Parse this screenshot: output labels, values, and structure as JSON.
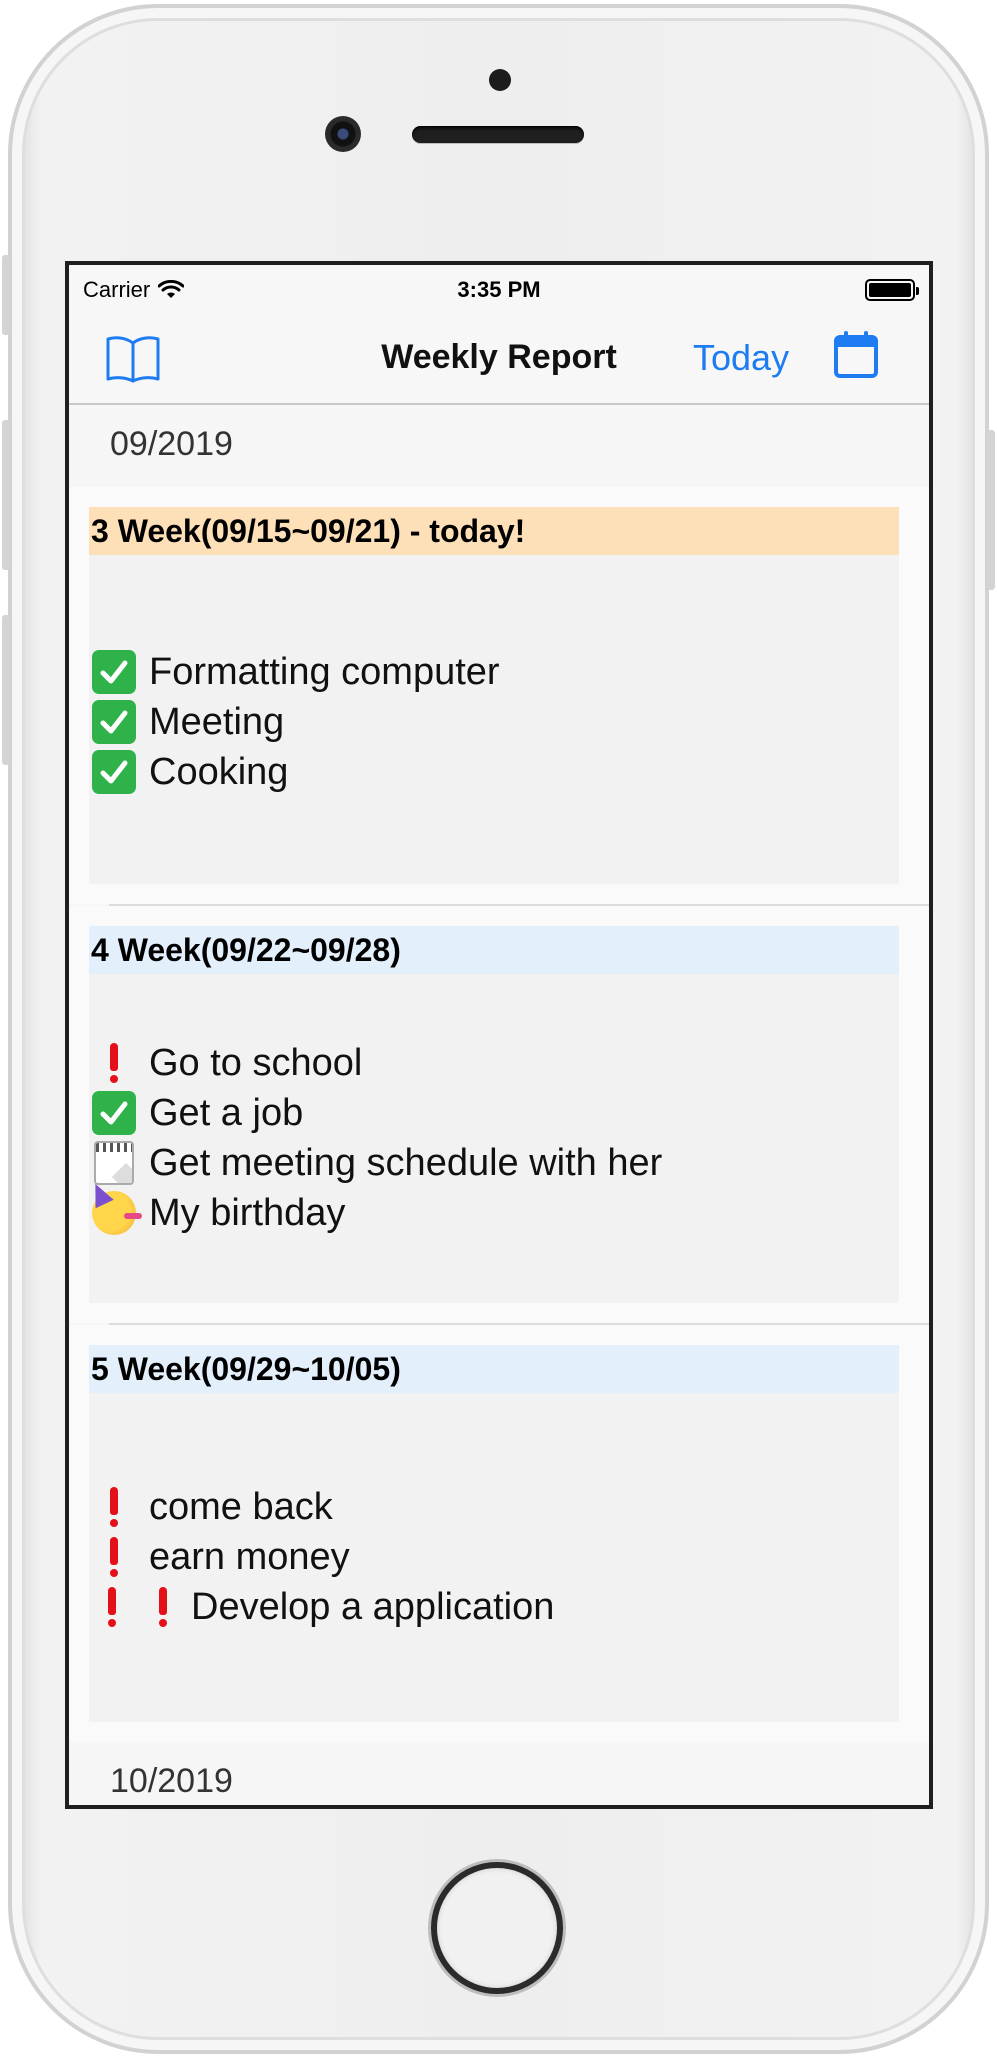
{
  "status_bar": {
    "carrier": "Carrier",
    "time": "3:35 PM"
  },
  "nav": {
    "title": "Weekly Report",
    "today_label": "Today",
    "left_icon": "book-icon",
    "right_icon": "calendar-icon"
  },
  "colors": {
    "accent": "#1e7cf2",
    "today_header": "#fde0b8",
    "week_header": "#e3effb",
    "check": "#2fb24a",
    "exclamation": "#e3101a"
  },
  "months": [
    {
      "label": "09/2019",
      "weeks": [
        {
          "title": "3 Week(09/15~09/21) - today!",
          "is_today": true,
          "items": [
            {
              "icon": "check-mark-icon",
              "text": "Formatting computer"
            },
            {
              "icon": "check-mark-icon",
              "text": "Meeting"
            },
            {
              "icon": "check-mark-icon",
              "text": "Cooking"
            }
          ]
        },
        {
          "title": "4 Week(09/22~09/28)",
          "is_today": false,
          "items": [
            {
              "icon": "exclamation-icon",
              "text": "Go to school"
            },
            {
              "icon": "check-mark-icon",
              "text": "Get a job"
            },
            {
              "icon": "calendar-note-icon",
              "text": "Get meeting schedule with her"
            },
            {
              "icon": "party-face-icon",
              "text": "My birthday"
            }
          ]
        },
        {
          "title": "5 Week(09/29~10/05)",
          "is_today": false,
          "items": [
            {
              "icon": "exclamation-icon",
              "text": "come back"
            },
            {
              "icon": "exclamation-icon",
              "text": "earn money"
            },
            {
              "icon": "double-exclamation-icon",
              "text": "Develop a application"
            }
          ]
        }
      ]
    },
    {
      "label": "10/2019",
      "weeks": []
    }
  ]
}
